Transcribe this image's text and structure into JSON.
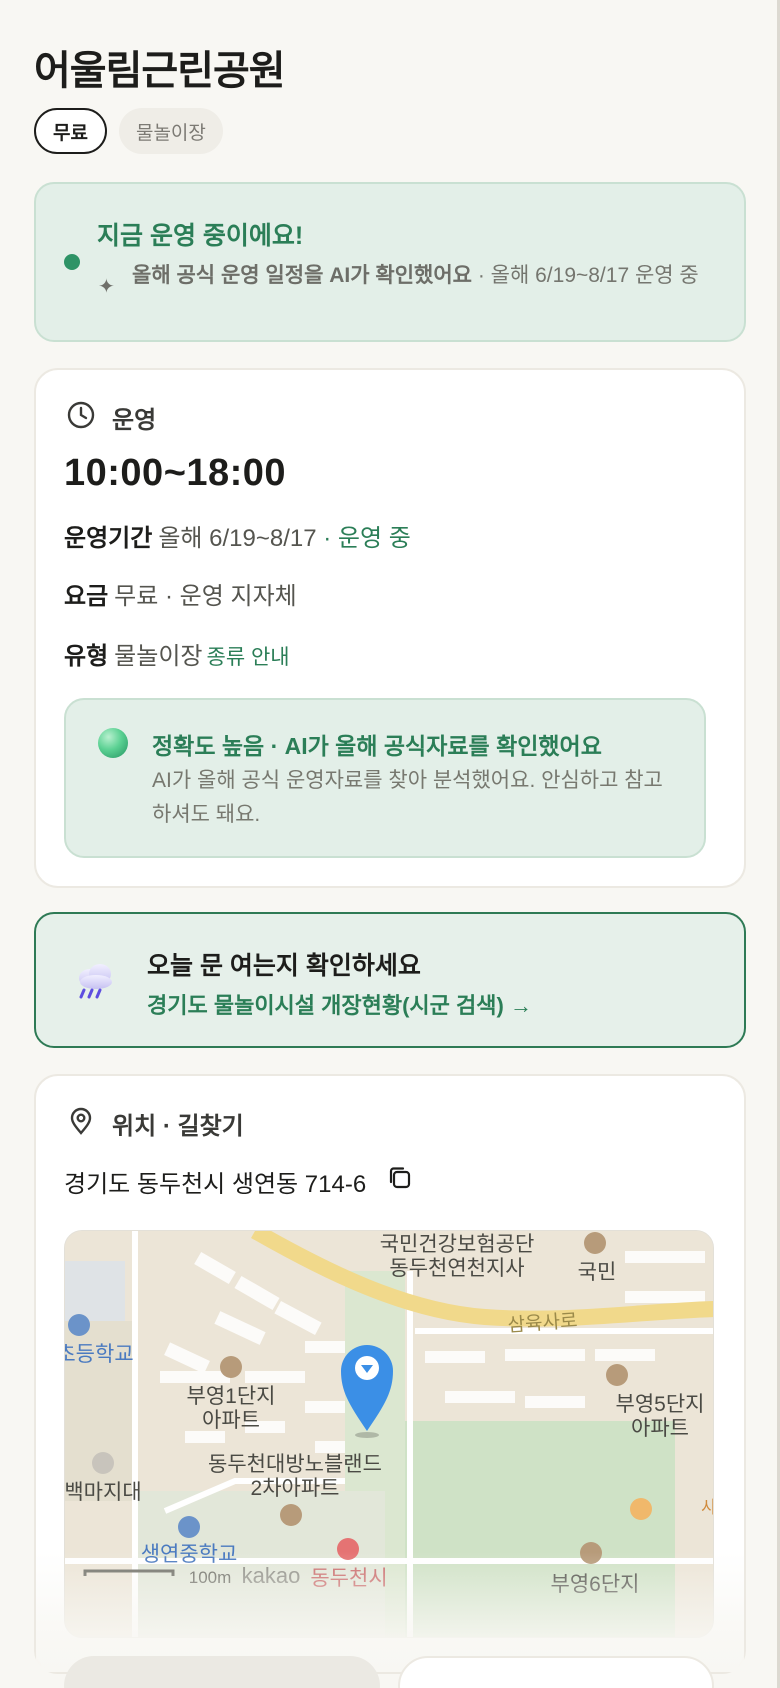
{
  "park": {
    "name": "어울림근린공원"
  },
  "chips": [
    {
      "label": "무료",
      "active": true
    },
    {
      "label": "물놀이장",
      "active": false
    }
  ],
  "status": {
    "heading": "지금 운영 중이에요!",
    "sub_bold": "올해 공식 운영 일정을 AI가 확인했어요",
    "sub_rest": " · 올해 6/19~8/17 운영 중"
  },
  "ops": {
    "section_label": "운영",
    "hours": "10:00~18:00",
    "period_label": "운영기간",
    "period_value": "올해 6/19~8/17",
    "period_status": " · 운영 중",
    "fee_label": "요금",
    "fee_value": "무료 · 운영 지자체",
    "type_label": "유형",
    "type_value": "물놀이장",
    "type_link": "종류 안내",
    "accuracy_title": "정확도 높음 · AI가 올해 공식자료를 확인했어요",
    "accuracy_desc": "AI가 올해 공식 운영자료를 찾아 분석했어요. 안심하고 참고하셔도 돼요."
  },
  "notice": {
    "title": "오늘 문 여는지 확인하세요",
    "link": "경기도 물놀이시설 개장현황(시군 검색) →"
  },
  "location": {
    "section_label": "위치 · 길찾기",
    "address": "경기도 동두천시 생연동 714-6",
    "map": {
      "labels": {
        "nhis": "국민건강보험공단",
        "nhis2": "동두천연천지사",
        "kookmin": "국민",
        "road": "삼육사로",
        "school1": "초등학교",
        "apt1a": "부영1단지",
        "apt1b": "아파트",
        "apt5a": "부영5단지",
        "apt5b": "아파트",
        "apt_big_a": "동두천대방노블랜드",
        "apt_big_b": "2차아파트",
        "baekma": "백마지대",
        "school2": "생연중학교",
        "scale": "100m",
        "brand": "kakao",
        "city": "동두천시",
        "apt6": "부영6단지",
        "edge": "사"
      }
    }
  },
  "colors": {
    "accent_green": "#2b7e57",
    "status_bg": "#e3efe8",
    "page_bg": "#f8f7f3",
    "pin_blue": "#3b8fe6"
  }
}
